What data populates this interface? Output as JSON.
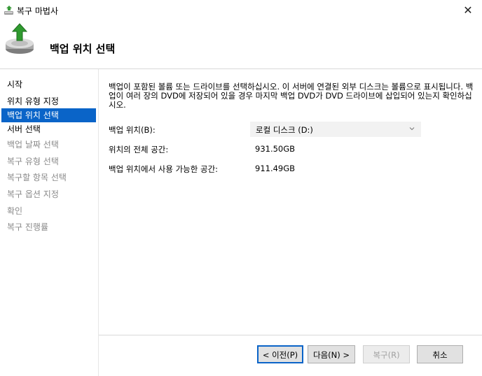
{
  "window": {
    "title": "복구 마법사",
    "close_glyph": "✕",
    "app_icon": "backup-app-icon"
  },
  "header": {
    "title": "백업 위치 선택",
    "icon": "restore-wizard-icon"
  },
  "sidebar": {
    "steps": [
      {
        "label": "시작",
        "state": "normal"
      },
      {
        "label": "위치 유형 지정",
        "state": "normal"
      },
      {
        "label": "백업 위치 선택",
        "state": "active"
      },
      {
        "label": "서버 선택",
        "state": "normal"
      },
      {
        "label": "백업 날짜 선택",
        "state": "disabled"
      },
      {
        "label": "복구 유형 선택",
        "state": "disabled"
      },
      {
        "label": "복구할 항목 선택",
        "state": "disabled"
      },
      {
        "label": "복구 옵션 지정",
        "state": "disabled"
      },
      {
        "label": "확인",
        "state": "disabled"
      },
      {
        "label": "복구 진행률",
        "state": "disabled"
      }
    ]
  },
  "main": {
    "description": "백업이 포함된 볼륨 또는 드라이브를 선택하십시오. 이 서버에 연결된 외부 디스크는 볼륨으로 표시됩니다. 백업이 여러 장의 DVD에 저장되어 있을 경우 마지막 백업 DVD가 DVD 드라이브에 삽입되어 있는지 확인하십시오.",
    "location_label": "백업 위치(B):",
    "location_selected": "로컬 디스크 (D:)",
    "total_space_label": "위치의 전체 공간:",
    "total_space_value": "931.50GB",
    "available_space_label": "백업 위치에서 사용 가능한 공간:",
    "available_space_value": "911.49GB"
  },
  "buttons": {
    "previous": "< 이전(P)",
    "next": "다음(N) >",
    "recover": "복구(R)",
    "cancel": "취소"
  },
  "colors": {
    "accent": "#0a64c8",
    "disabled_text": "#8a8a8a"
  }
}
